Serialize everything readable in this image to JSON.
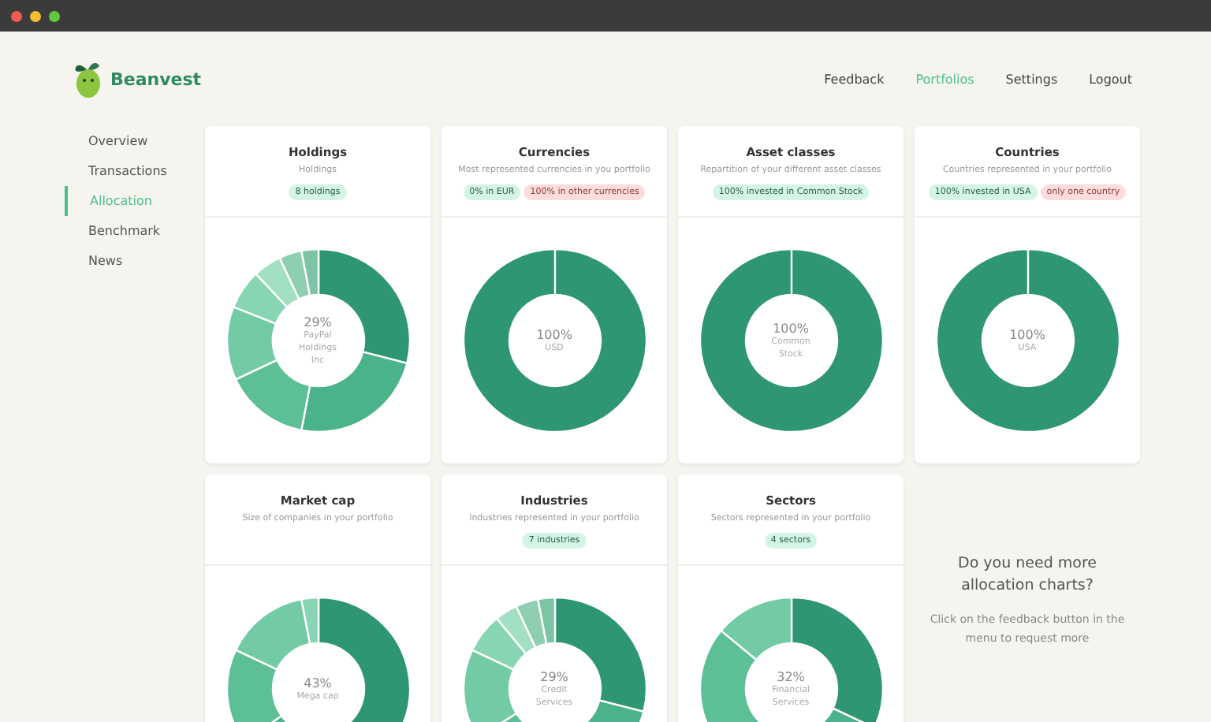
{
  "brand": {
    "name": "Beanvest"
  },
  "nav": [
    {
      "label": "Feedback",
      "selected": false
    },
    {
      "label": "Portfolios",
      "selected": true
    },
    {
      "label": "Settings",
      "selected": false
    },
    {
      "label": "Logout",
      "selected": false
    }
  ],
  "sidebar": {
    "items": [
      {
        "label": "Overview",
        "selected": false
      },
      {
        "label": "Transactions",
        "selected": false
      },
      {
        "label": "Allocation",
        "selected": true
      },
      {
        "label": "Benchmark",
        "selected": false
      },
      {
        "label": "News",
        "selected": false
      }
    ]
  },
  "cards": [
    {
      "title": "Holdings",
      "subtitle": "Holdings",
      "badges": [
        {
          "text": "8 holdings",
          "kind": "info"
        }
      ],
      "center_value": "29%",
      "center_label": "PayPal Holdings Inc"
    },
    {
      "title": "Currencies",
      "subtitle": "Most represented currencies in you portfolio",
      "badges": [
        {
          "text": "0% in EUR",
          "kind": "info"
        },
        {
          "text": "100% in other currencies",
          "kind": "warning"
        }
      ],
      "center_value": "100%",
      "center_label": "USD"
    },
    {
      "title": "Asset classes",
      "subtitle": "Repartition of your different asset classes",
      "badges": [
        {
          "text": "100% invested in Common Stock",
          "kind": "info"
        }
      ],
      "center_value": "100%",
      "center_label": "Common Stock"
    },
    {
      "title": "Countries",
      "subtitle": "Countries represented in your portfolio",
      "badges": [
        {
          "text": "100% invested in USA",
          "kind": "info"
        },
        {
          "text": "only one country",
          "kind": "warning"
        }
      ],
      "center_value": "100%",
      "center_label": "USA"
    },
    {
      "title": "Market cap",
      "subtitle": "Size of companies in your portfolio",
      "center_value": "43%",
      "center_label": "Mega cap"
    },
    {
      "title": "Industries",
      "subtitle": "Industries represented in your portfolio",
      "badges": [
        {
          "text": "7 industries",
          "kind": "info"
        }
      ],
      "center_value": "29%",
      "center_label": "Credit Services"
    },
    {
      "title": "Sectors",
      "subtitle": "Sectors represented in your portfolio",
      "badges": [
        {
          "text": "4 sectors",
          "kind": "info"
        }
      ],
      "center_value": "32%",
      "center_label": "Financial Services"
    }
  ],
  "promo": {
    "heading": "Do you need more allocation charts?",
    "text": "Click on the feedback button in the menu to request more"
  }
}
